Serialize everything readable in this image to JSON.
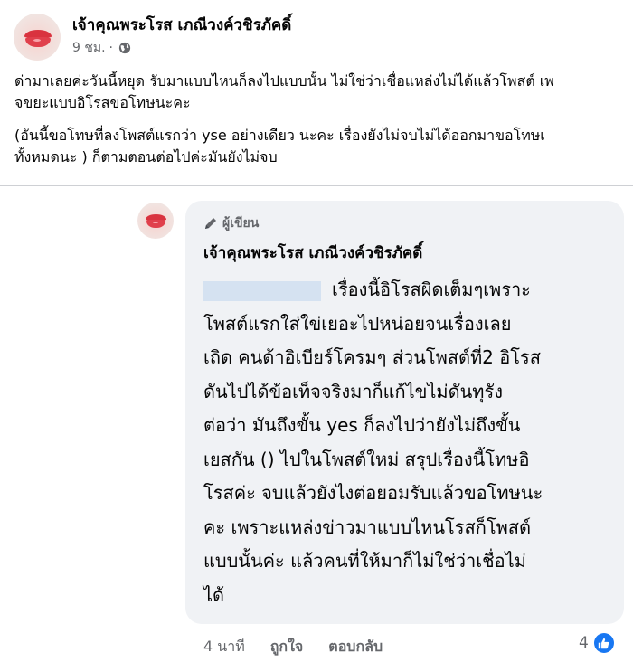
{
  "post": {
    "author": "เจ้าคุณพระโรส เภณีวงค์วชิรภัคดิ์",
    "timestamp": "9 ชม.",
    "separator": "·",
    "privacy_icon": "globe-icon",
    "paragraphs": [
      [
        "ด่ามาเลยค่ะวันนี้หยุด รับมาแบบไหนก็ลงไปแบบนั้น ไม่ใช่ว่าเชื่อแหล่งไม่ได้แล้วโพสต์ เพ",
        "จขยะแบบอิโรสขอโทษนะคะ"
      ],
      [
        "(อันนี้ขอโทษที่ลงโพสต์แรกว่า yse อย่างเดียว นะคะ เรื่องยังไม่จบไม่ได้ออกมาขอโทษเ",
        "ทั้งหมดนะ ) ก็ตามตอนต่อไปค่ะมันยังไม่จบ"
      ]
    ]
  },
  "comment": {
    "badge_icon": "pen-icon",
    "badge_label": "ผู้เขียน",
    "author": "เจ้าคุณพระโรส เภณีวงค์วชิรภัคดิ์",
    "lines": [
      "เรื่องนี้อิโรสผิดเต็มๆเพราะ",
      "โพสต์แรกใส่ใข่เยอะไปหน่อยจนเรื่องเลย",
      "เถิด คนด้าอิเบียร์โครมๆ ส่วนโพสต์ที่2 อิโรส",
      "ดันไปได้ข้อเท็จจริงมาก็แก้ไขไม่ดันทุรัง",
      "ต่อว่า มันถึงขั้น yes ก็ลงไปว่ายังไม่ถึงขั้น",
      "เยสกัน () ไปในโพสต์ใหม่ สรุปเรื่องนี้โทษอิ",
      "โรสค่ะ จบแล้วยังไงต่อยอมรับแล้วขอโทษนะ",
      "คะ เพราะแหล่งข่าวมาแบบไหนโรสก็โพสต์",
      "แบบนั้นค่ะ แล้วคนที่ให้มาก็ไม่ใช่ว่าเชื่อไม่",
      "ได้"
    ],
    "time": "4 นาที",
    "like_label": "ถูกใจ",
    "reply_label": "ตอบกลับ",
    "reaction_count": "4",
    "reaction_icon": "like-icon"
  },
  "colors": {
    "like_blue": "#1877f2",
    "bubble_bg": "#f0f2f5",
    "secondary_text": "#65676b"
  }
}
